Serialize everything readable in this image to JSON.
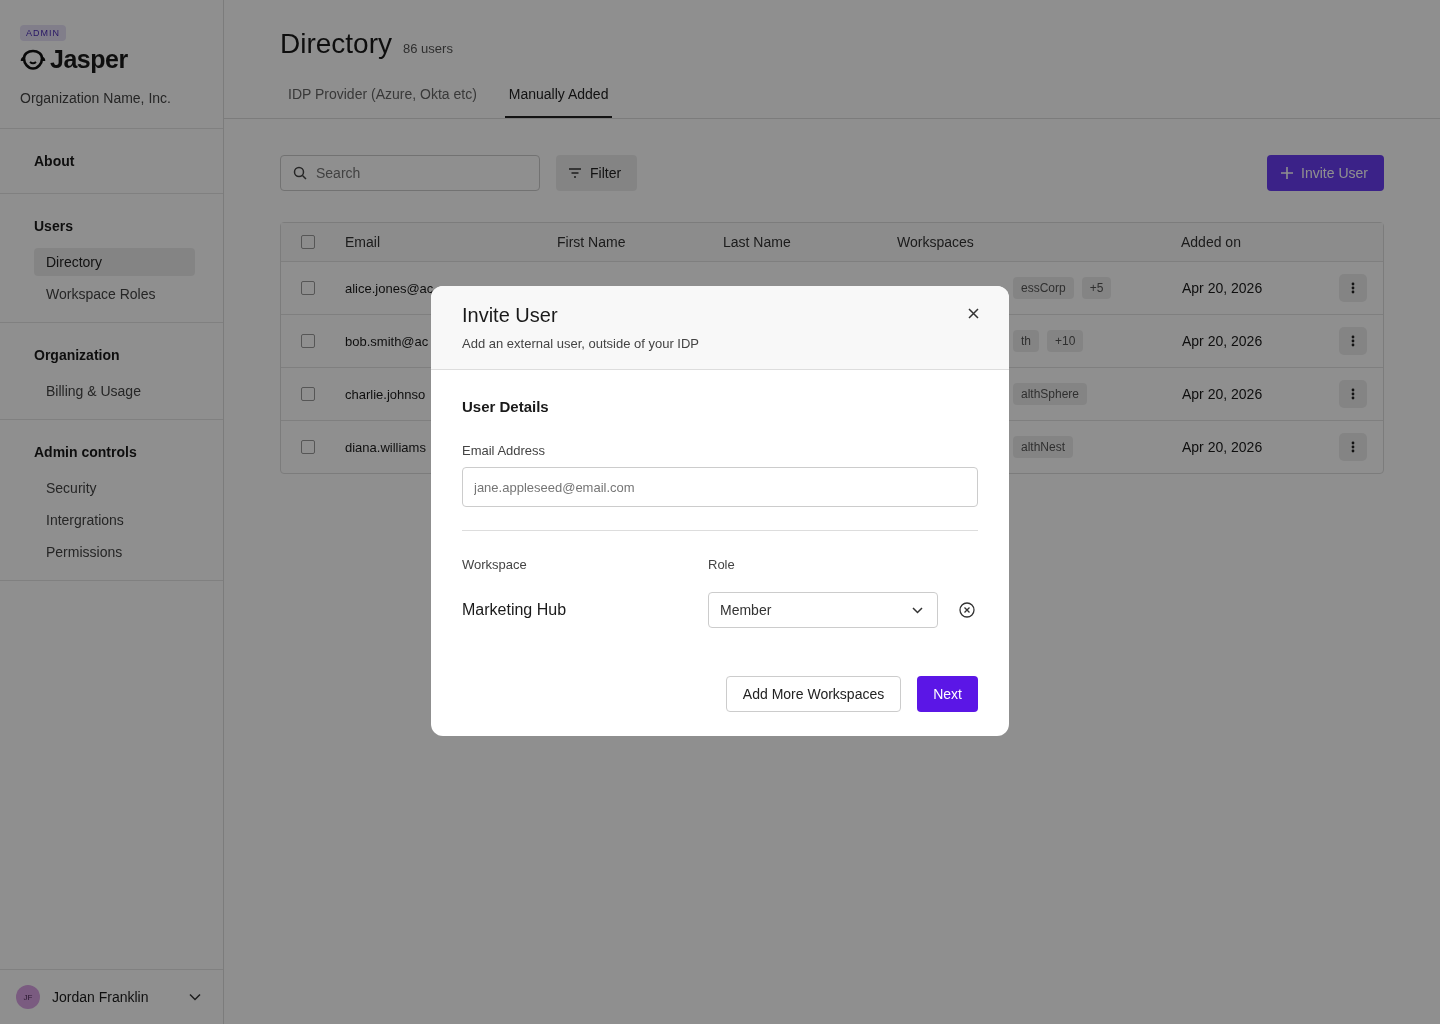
{
  "sidebar": {
    "badge": "ADMIN",
    "logo": "Jasper",
    "org": "Organization Name, Inc.",
    "sections": [
      {
        "title": "About"
      },
      {
        "title": "Users",
        "items": [
          {
            "label": "Directory",
            "selected": true
          },
          {
            "label": "Workspace Roles",
            "selected": false
          }
        ]
      },
      {
        "title": "Organization",
        "items": [
          {
            "label": "Billing & Usage",
            "selected": false
          }
        ]
      },
      {
        "title": "Admin controls",
        "items": [
          {
            "label": "Security",
            "selected": false
          },
          {
            "label": "Intergrations",
            "selected": false
          },
          {
            "label": "Permissions",
            "selected": false
          }
        ]
      }
    ],
    "user": {
      "initials": "JF",
      "name": "Jordan Franklin"
    }
  },
  "header": {
    "title": "Directory",
    "count": "86 users"
  },
  "tabs": [
    {
      "label": "IDP Provider (Azure, Okta etc)",
      "selected": false
    },
    {
      "label": "Manually Added",
      "selected": true
    }
  ],
  "toolbar": {
    "search_placeholder": "Search",
    "filter": "Filter",
    "invite": "Invite User"
  },
  "table": {
    "header_checked": false,
    "columns": [
      "Email",
      "First Name",
      "Last Name",
      "Workspaces",
      "Added on"
    ],
    "rows": [
      {
        "checked": false,
        "email": "alice.jones@ac",
        "workspaces": [
          "essCorp",
          "+5"
        ],
        "added_on": "Apr 20, 2026"
      },
      {
        "checked": false,
        "email": "bob.smith@ac",
        "workspaces": [
          "th",
          "+10"
        ],
        "added_on": "Apr 20, 2026"
      },
      {
        "checked": false,
        "email": "charlie.johnso",
        "workspaces": [
          "althSphere"
        ],
        "added_on": "Apr 20, 2026"
      },
      {
        "checked": false,
        "email": "diana.williams",
        "workspaces": [
          "althNest"
        ],
        "added_on": "Apr 20, 2026"
      }
    ]
  },
  "dialog": {
    "title": "Invite User",
    "subtitle": "Add an external user, outside of your IDP",
    "section": "User Details",
    "email_label": "Email Address",
    "email_placeholder": "jane.appleseed@email.com",
    "workspace_label": "Workspace",
    "role_label": "Role",
    "assignments": [
      {
        "workspace": "Marketing Hub",
        "role": "Member"
      }
    ],
    "secondary": "Add More Workspaces",
    "primary": "Next"
  }
}
